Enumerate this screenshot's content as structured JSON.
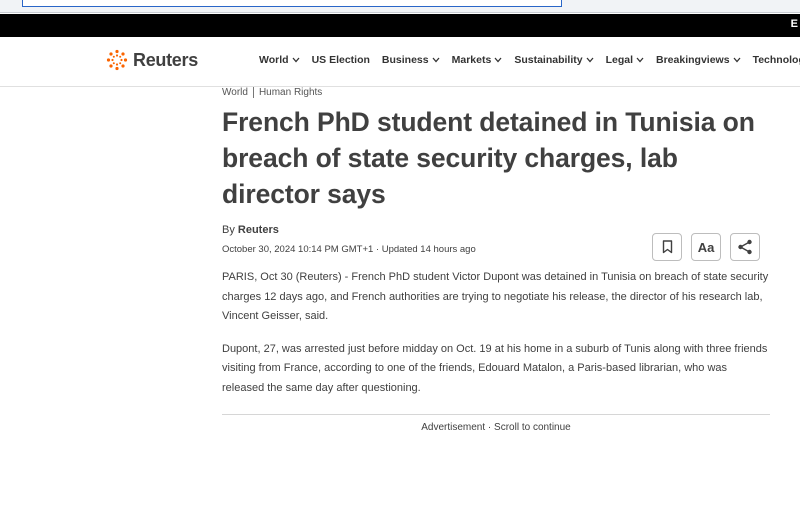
{
  "browser": {
    "address_text": ""
  },
  "topbar": {
    "edge_text": "E"
  },
  "brand": {
    "name": "Reuters"
  },
  "nav": {
    "items": [
      {
        "label": "World",
        "has_chevron": true
      },
      {
        "label": "US Election",
        "has_chevron": false
      },
      {
        "label": "Business",
        "has_chevron": true
      },
      {
        "label": "Markets",
        "has_chevron": true
      },
      {
        "label": "Sustainability",
        "has_chevron": true
      },
      {
        "label": "Legal",
        "has_chevron": true
      },
      {
        "label": "Breakingviews",
        "has_chevron": true
      },
      {
        "label": "Technology",
        "has_chevron": true
      }
    ]
  },
  "article": {
    "breadcrumb": [
      "World",
      "Human Rights"
    ],
    "headline": "French PhD student detained in Tunisia on breach of state security charges, lab director says",
    "byline_prefix": "By",
    "author": "Reuters",
    "dateline": "October 30, 2024 10:14 PM GMT+1 · Updated 14 hours ago",
    "actions": {
      "bookmark": "bookmark-icon",
      "text_size": "Aa",
      "share": "share-icon"
    },
    "paragraphs": [
      "PARIS, Oct 30 (Reuters) - French PhD student Victor Dupont was detained in Tunisia on breach of state security charges 12 days ago, and French authorities are trying to negotiate his release, the director of his research lab, Vincent Geisser, said.",
      "Dupont, 27, was arrested just before midday on Oct. 19 at his home in a suburb of Tunis along with three friends visiting from France, according to one of the friends, Edouard Matalon, a Paris-based librarian, who was released the same day after questioning."
    ],
    "ad_label": "Advertisement · Scroll to continue"
  },
  "colors": {
    "brand_orange": "#fa6400",
    "text": "#404040",
    "topbar": "#000000"
  }
}
